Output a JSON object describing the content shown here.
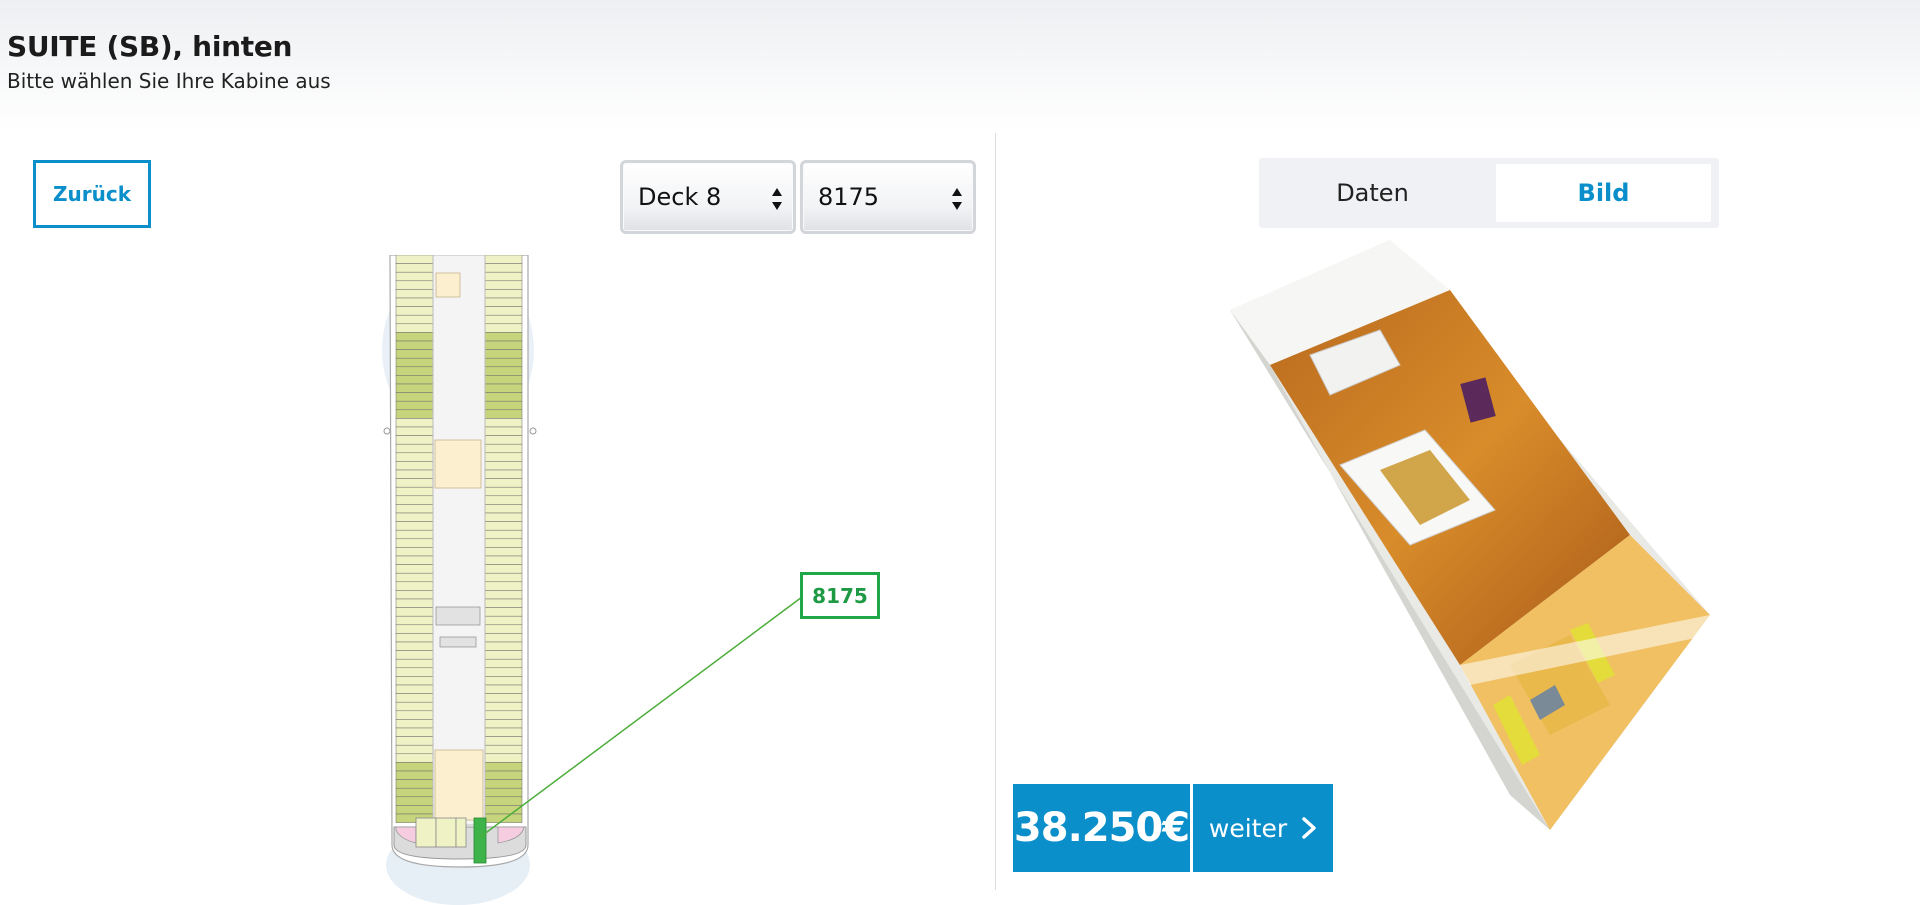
{
  "header": {
    "title": "SUITE (SB), hinten",
    "subtitle": "Bitte wählen Sie Ihre Kabine aus"
  },
  "controls": {
    "back_label": "Zurück",
    "deck_select_value": "Deck 8",
    "cabin_select_value": "8175"
  },
  "tabs": [
    {
      "label": "Daten",
      "active": false
    },
    {
      "label": "Bild",
      "active": true
    }
  ],
  "deck_plan": {
    "selected_cabin_label": "8175"
  },
  "booking": {
    "price": "38.250€",
    "next_label": "weiter"
  },
  "colors": {
    "accent": "#0a8fcb",
    "selected_cabin": "#20a848",
    "cabin_light": "#eef2c4",
    "cabin_dark": "#c6d47c"
  },
  "icons": [
    "chevron-right-icon",
    "select-arrows-icon"
  ]
}
